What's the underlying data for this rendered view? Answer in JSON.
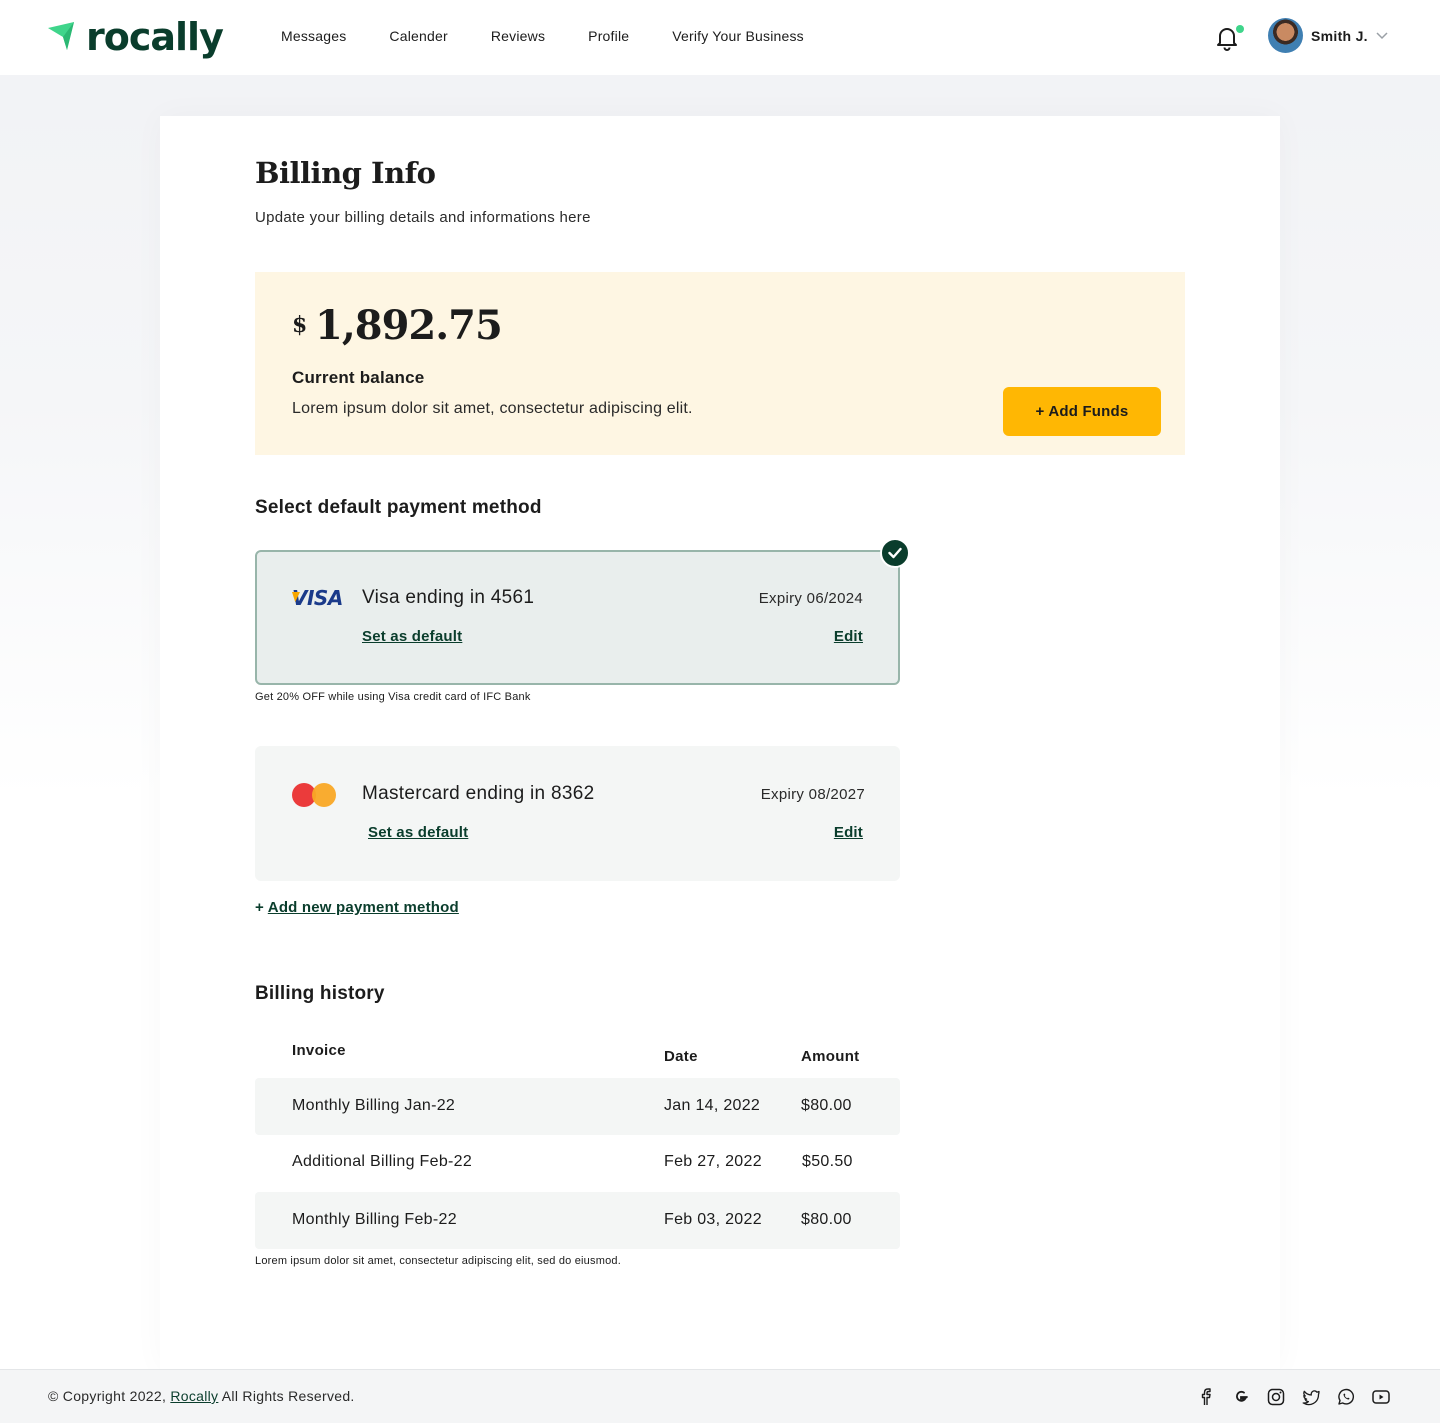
{
  "header": {
    "logo_text": "rocally",
    "nav": [
      "Messages",
      "Calender",
      "Reviews",
      "Profile",
      "Verify Your Business"
    ],
    "user_name": "Smith J."
  },
  "page": {
    "title": "Billing Info",
    "subtitle": "Update your billing details and informations here"
  },
  "balance": {
    "currency": "$",
    "amount": "1,892.75",
    "label": "Current balance",
    "description": "Lorem ipsum dolor sit amet, consectetur adipiscing elit.",
    "add_funds_label": "+ Add Funds"
  },
  "payment": {
    "heading": "Select default payment method",
    "methods": [
      {
        "brand": "VISA",
        "name": "Visa ending in 4561",
        "expiry": "Expiry 06/2024",
        "set_default": "Set as default",
        "edit": "Edit",
        "selected": true
      },
      {
        "brand": "mastercard",
        "name": "Mastercard ending in 8362",
        "expiry": "Expiry 08/2027",
        "set_default": "Set as default",
        "edit": "Edit",
        "selected": false
      }
    ],
    "promo": "Get 20% OFF while using Visa credit card of IFC Bank",
    "add_prefix": "+ ",
    "add_label": "Add new payment method"
  },
  "history": {
    "heading": "Billing history",
    "columns": [
      "Invoice",
      "Date",
      "Amount"
    ],
    "rows": [
      {
        "invoice": "Monthly Billing Jan-22",
        "date": "Jan 14, 2022",
        "amount": "$80.00"
      },
      {
        "invoice": "Additional Billing Feb-22",
        "date": "Feb 27, 2022",
        "amount": "$50.50"
      },
      {
        "invoice": "Monthly Billing Feb-22",
        "date": "Feb 03, 2022",
        "amount": "$80.00"
      }
    ],
    "note": "Lorem ipsum dolor sit amet, consectetur adipiscing elit, sed do eiusmod."
  },
  "footer": {
    "copyright_prefix": "© Copyright 2022, ",
    "brand": "Rocally",
    "copyright_suffix": " All Rights Reserved.",
    "socials": [
      "facebook-icon",
      "google-icon",
      "instagram-icon",
      "twitter-icon",
      "whatsapp-icon",
      "youtube-icon"
    ]
  },
  "colors": {
    "brand_green": "#0a3d2c",
    "accent_green": "#3fd58b",
    "cta_yellow": "#ffb703",
    "balance_bg": "#fef6e3"
  }
}
